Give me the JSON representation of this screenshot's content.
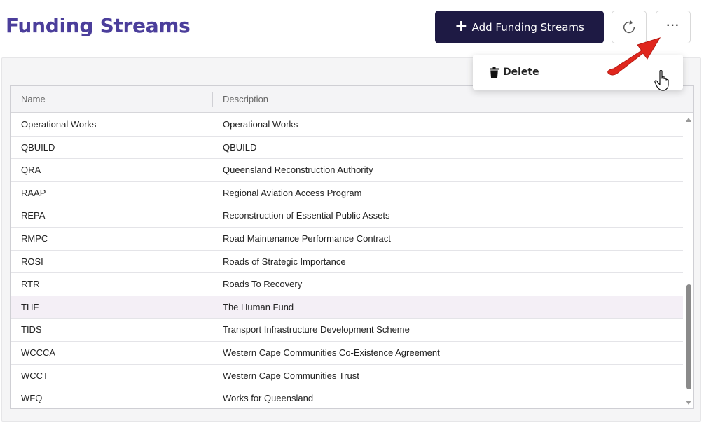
{
  "header": {
    "title": "Funding Streams",
    "add_button_label": "Add Funding Streams",
    "add_button_icon": "plus-icon",
    "refresh_icon": "refresh-icon",
    "more_icon": "more-horizontal-icon",
    "more_label": "···"
  },
  "menu": {
    "items": [
      {
        "label": "Delete",
        "icon": "trash-icon"
      }
    ]
  },
  "grid": {
    "columns": [
      "Name",
      "Description"
    ],
    "rows": [
      {
        "name": "Operational Works",
        "description": "Operational Works"
      },
      {
        "name": "QBUILD",
        "description": "QBUILD"
      },
      {
        "name": "QRA",
        "description": "Queensland Reconstruction Authority"
      },
      {
        "name": "RAAP",
        "description": "Regional Aviation Access Program"
      },
      {
        "name": "REPA",
        "description": "Reconstruction of Essential Public Assets"
      },
      {
        "name": "RMPC",
        "description": "Road Maintenance Performance Contract"
      },
      {
        "name": "ROSI",
        "description": "Roads of Strategic Importance"
      },
      {
        "name": "RTR",
        "description": "Roads To Recovery"
      },
      {
        "name": "THF",
        "description": "The Human Fund"
      },
      {
        "name": "TIDS",
        "description": "Transport Infrastructure Development Scheme"
      },
      {
        "name": "WCCCA",
        "description": "Western Cape Communities Co-Existence Agreement"
      },
      {
        "name": "WCCT",
        "description": "Western Cape Communities Trust"
      },
      {
        "name": "WFQ",
        "description": "Works for Queensland"
      }
    ],
    "highlighted_row": "THF"
  },
  "colors": {
    "title": "#4b3e9b",
    "primary_button": "#1e1a44",
    "annotation_arrow": "#e0261d",
    "row_highlight": "#f4eff6"
  }
}
